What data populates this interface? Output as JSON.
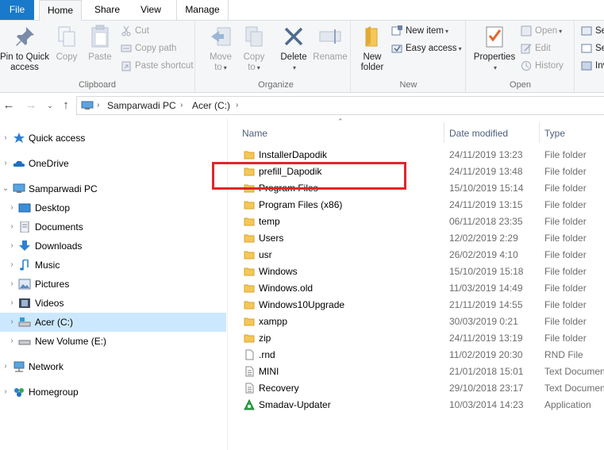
{
  "tabs": {
    "file": "File",
    "home": "Home",
    "share": "Share",
    "view": "View",
    "manage": "Manage"
  },
  "ribbon": {
    "clipboard": {
      "label": "Clipboard",
      "pin_line1": "Pin to Quick",
      "pin_line2": "access",
      "copy": "Copy",
      "paste": "Paste",
      "cut": "Cut",
      "copy_path": "Copy path",
      "paste_shortcut": "Paste shortcut"
    },
    "organize": {
      "label": "Organize",
      "move_line1": "Move",
      "move_line2": "to",
      "copy_line1": "Copy",
      "copy_line2": "to",
      "delete": "Delete",
      "rename": "Rename"
    },
    "new": {
      "label": "New",
      "new_folder_line1": "New",
      "new_folder_line2": "folder",
      "new_item": "New item",
      "easy_access": "Easy access"
    },
    "open": {
      "label": "Open",
      "properties": "Properties",
      "open": "Open",
      "edit": "Edit",
      "history": "History"
    },
    "select": {
      "select_all": "Se",
      "select_none": "Se",
      "invert": "Inv"
    }
  },
  "address": {
    "crumbs": [
      "Samparwadi PC",
      "Acer (C:)"
    ]
  },
  "nav": {
    "items": [
      {
        "label": "Quick access"
      },
      {
        "label": "OneDrive"
      },
      {
        "label": "Samparwadi PC"
      },
      {
        "label": "Desktop"
      },
      {
        "label": "Documents"
      },
      {
        "label": "Downloads"
      },
      {
        "label": "Music"
      },
      {
        "label": "Pictures"
      },
      {
        "label": "Videos"
      },
      {
        "label": "Acer (C:)"
      },
      {
        "label": "New Volume (E:)"
      },
      {
        "label": "Network"
      },
      {
        "label": "Homegroup"
      }
    ]
  },
  "columns": {
    "name": "Name",
    "date": "Date modified",
    "type": "Type"
  },
  "files": [
    {
      "name": "InstallerDapodik",
      "date": "24/11/2019 13:23",
      "type": "File folder",
      "icon": "folder"
    },
    {
      "name": "prefill_Dapodik",
      "date": "24/11/2019 13:48",
      "type": "File folder",
      "icon": "folder"
    },
    {
      "name": "Program Files",
      "date": "15/10/2019 15:14",
      "type": "File folder",
      "icon": "folder"
    },
    {
      "name": "Program Files (x86)",
      "date": "24/11/2019 13:15",
      "type": "File folder",
      "icon": "folder"
    },
    {
      "name": "temp",
      "date": "06/11/2018 23:35",
      "type": "File folder",
      "icon": "folder"
    },
    {
      "name": "Users",
      "date": "12/02/2019 2:29",
      "type": "File folder",
      "icon": "folder"
    },
    {
      "name": "usr",
      "date": "26/02/2019 4:10",
      "type": "File folder",
      "icon": "folder"
    },
    {
      "name": "Windows",
      "date": "15/10/2019 15:18",
      "type": "File folder",
      "icon": "folder"
    },
    {
      "name": "Windows.old",
      "date": "11/03/2019 14:49",
      "type": "File folder",
      "icon": "folder"
    },
    {
      "name": "Windows10Upgrade",
      "date": "21/11/2019 14:55",
      "type": "File folder",
      "icon": "folder"
    },
    {
      "name": "xampp",
      "date": "30/03/2019 0:21",
      "type": "File folder",
      "icon": "folder"
    },
    {
      "name": "zip",
      "date": "24/11/2019 13:19",
      "type": "File folder",
      "icon": "folder"
    },
    {
      "name": ".rnd",
      "date": "11/02/2019 20:30",
      "type": "RND File",
      "icon": "file"
    },
    {
      "name": "MINI",
      "date": "21/01/2018 15:01",
      "type": "Text Document",
      "icon": "text"
    },
    {
      "name": "Recovery",
      "date": "29/10/2018 23:17",
      "type": "Text Document",
      "icon": "text"
    },
    {
      "name": "Smadav-Updater",
      "date": "10/03/2014 14:23",
      "type": "Application",
      "icon": "app"
    }
  ],
  "colors": {
    "accent": "#1979ca",
    "selection": "#cce8ff",
    "folder": "#e8b64c",
    "highlight_box": "#e1262a"
  }
}
